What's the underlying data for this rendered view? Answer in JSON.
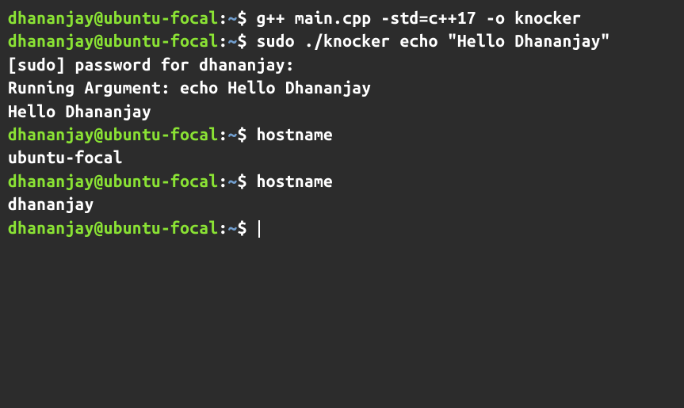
{
  "prompt": {
    "user_host": "dhananjay@ubuntu-focal",
    "colon": ":",
    "path": "~",
    "symbol": "$"
  },
  "lines": [
    {
      "type": "prompt",
      "command": "g++ main.cpp -std=c++17 -o knocker"
    },
    {
      "type": "prompt",
      "command": "sudo ./knocker echo \"Hello Dhananjay\""
    },
    {
      "type": "output",
      "text": "[sudo] password for dhananjay:"
    },
    {
      "type": "output",
      "text": "Running Argument: echo Hello Dhananjay"
    },
    {
      "type": "output",
      "text": "Hello Dhananjay"
    },
    {
      "type": "prompt",
      "command": "hostname"
    },
    {
      "type": "output",
      "text": "ubuntu-focal"
    },
    {
      "type": "prompt",
      "command": "hostname"
    },
    {
      "type": "output",
      "text": "dhananjay"
    },
    {
      "type": "cursor"
    }
  ]
}
